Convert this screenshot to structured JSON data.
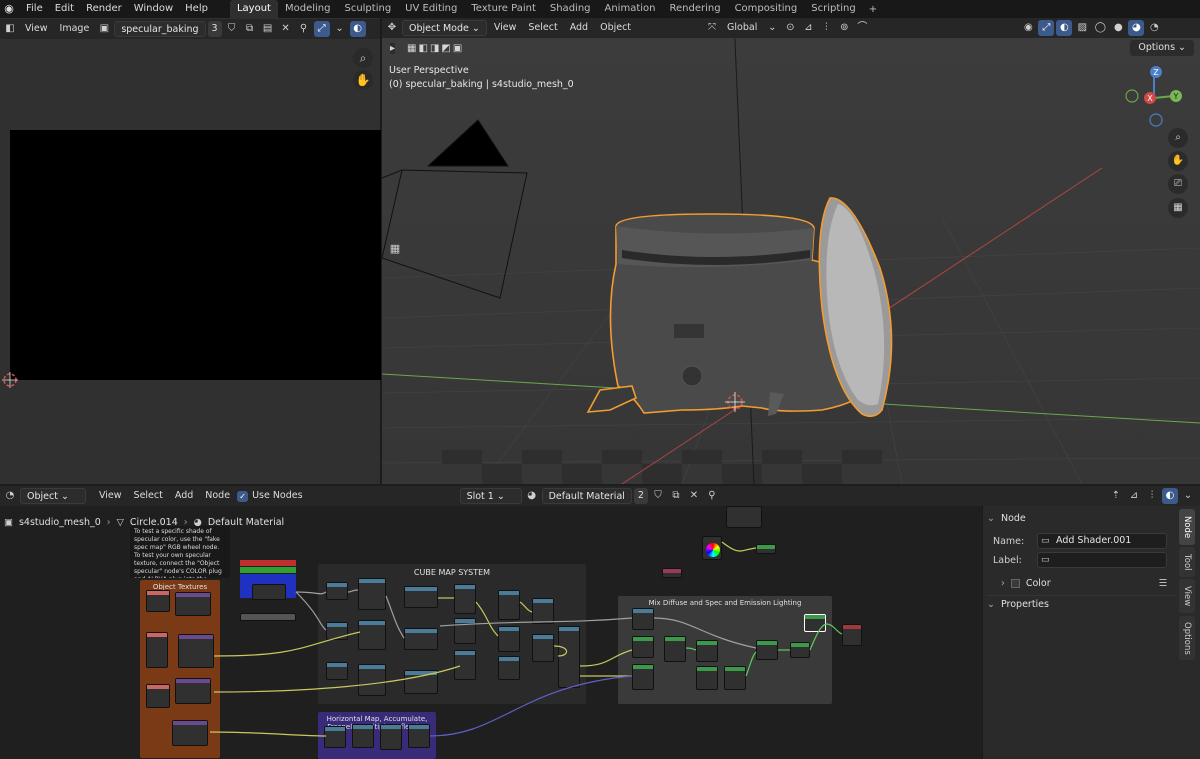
{
  "topbar": {
    "menus": [
      "File",
      "Edit",
      "Render",
      "Window",
      "Help"
    ],
    "workspaces": [
      "Layout",
      "Modeling",
      "Sculpting",
      "UV Editing",
      "Texture Paint",
      "Shading",
      "Animation",
      "Rendering",
      "Compositing",
      "Scripting"
    ],
    "active_workspace": "Layout",
    "add_tab": "+"
  },
  "image_editor": {
    "menus": [
      "View",
      "Image"
    ],
    "image_name": "specular_baking",
    "users": "3"
  },
  "viewport": {
    "mode": "Object Mode",
    "menus": [
      "View",
      "Select",
      "Add",
      "Object"
    ],
    "transform_orientation": "Global",
    "options_label": "Options",
    "perspective_label": "User Perspective",
    "collection_label": "(0) specular_baking | s4studio_mesh_0",
    "gizmo": {
      "z": "Z",
      "x": "X",
      "y": "Y"
    },
    "colors": {
      "selection_outline": "#f39c32",
      "x_axis": "#c04848",
      "y_axis": "#6aa84f"
    }
  },
  "node_editor": {
    "type": "Object",
    "menus": [
      "View",
      "Select",
      "Add",
      "Node"
    ],
    "use_nodes_label": "Use Nodes",
    "slot": "Slot 1",
    "material": "Default Material",
    "material_users": "2",
    "breadcrumb": [
      "s4studio_mesh_0",
      "Circle.014",
      "Default Material"
    ],
    "note_text": "To test a specific shade of specular color, use the \"fake spec map\" RGB wheel node. To test your own specular texture, connect the \"Object specular\" node's COLOR plug and ALPHA plug into the \"specular map",
    "frames": {
      "cube_map": "CUBE MAP SYSTEM",
      "object_textures": "Object Textures",
      "mix": "Mix Diffuse and Spec and Emission Lighting",
      "bottom": "Horizontal Map, Accumulate, Fresnel & Multiply Reflection"
    }
  },
  "sidebar": {
    "node_header": "Node",
    "name_label": "Name:",
    "name_value": "Add Shader.001",
    "label_label": "Label:",
    "label_value": "",
    "color_label": "Color",
    "properties_label": "Properties",
    "tabs": [
      "Node",
      "Tool",
      "View",
      "Options"
    ]
  }
}
